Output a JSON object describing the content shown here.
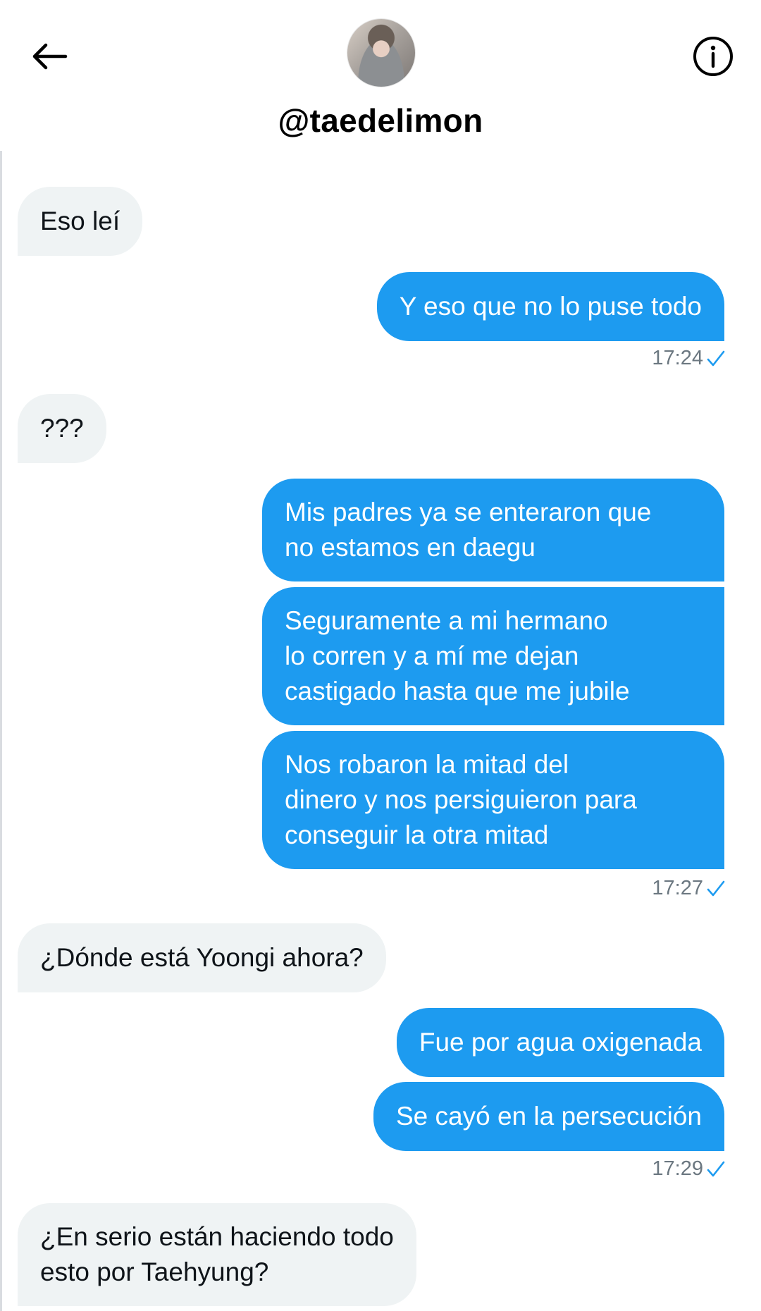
{
  "header": {
    "username": "@taedelimon",
    "back_icon": "arrow-left-icon",
    "info_icon": "info-circle-icon",
    "accent": "#1d9bf0"
  },
  "messages": [
    {
      "direction": "incoming",
      "lines": [
        "Eso leí"
      ]
    },
    {
      "direction": "outgoing",
      "lines": [
        "Y eso que no lo puse todo"
      ]
    },
    {
      "direction": "incoming",
      "lines": [
        "???"
      ]
    },
    {
      "direction": "outgoing",
      "lines": [
        "Mis padres ya se enteraron que",
        "no estamos en daegu"
      ]
    },
    {
      "direction": "outgoing",
      "lines": [
        "Seguramente a mi hermano",
        "lo corren y a mí me dejan",
        "castigado hasta que me jubile"
      ]
    },
    {
      "direction": "outgoing",
      "lines": [
        "Nos robaron la mitad del",
        "dinero y nos persiguieron para",
        "conseguir la otra mitad"
      ]
    },
    {
      "direction": "incoming",
      "lines": [
        "¿Dónde está Yoongi ahora?"
      ]
    },
    {
      "direction": "outgoing",
      "lines": [
        "Fue por agua oxigenada"
      ]
    },
    {
      "direction": "outgoing",
      "lines": [
        "Se cayó en la persecución"
      ]
    },
    {
      "direction": "incoming",
      "lines": [
        "¿En serio están haciendo todo",
        "esto por Taehyung?"
      ]
    }
  ],
  "timestamps": [
    "17:24",
    "17:27",
    "17:29"
  ],
  "status_icon": "sent-check-icon"
}
